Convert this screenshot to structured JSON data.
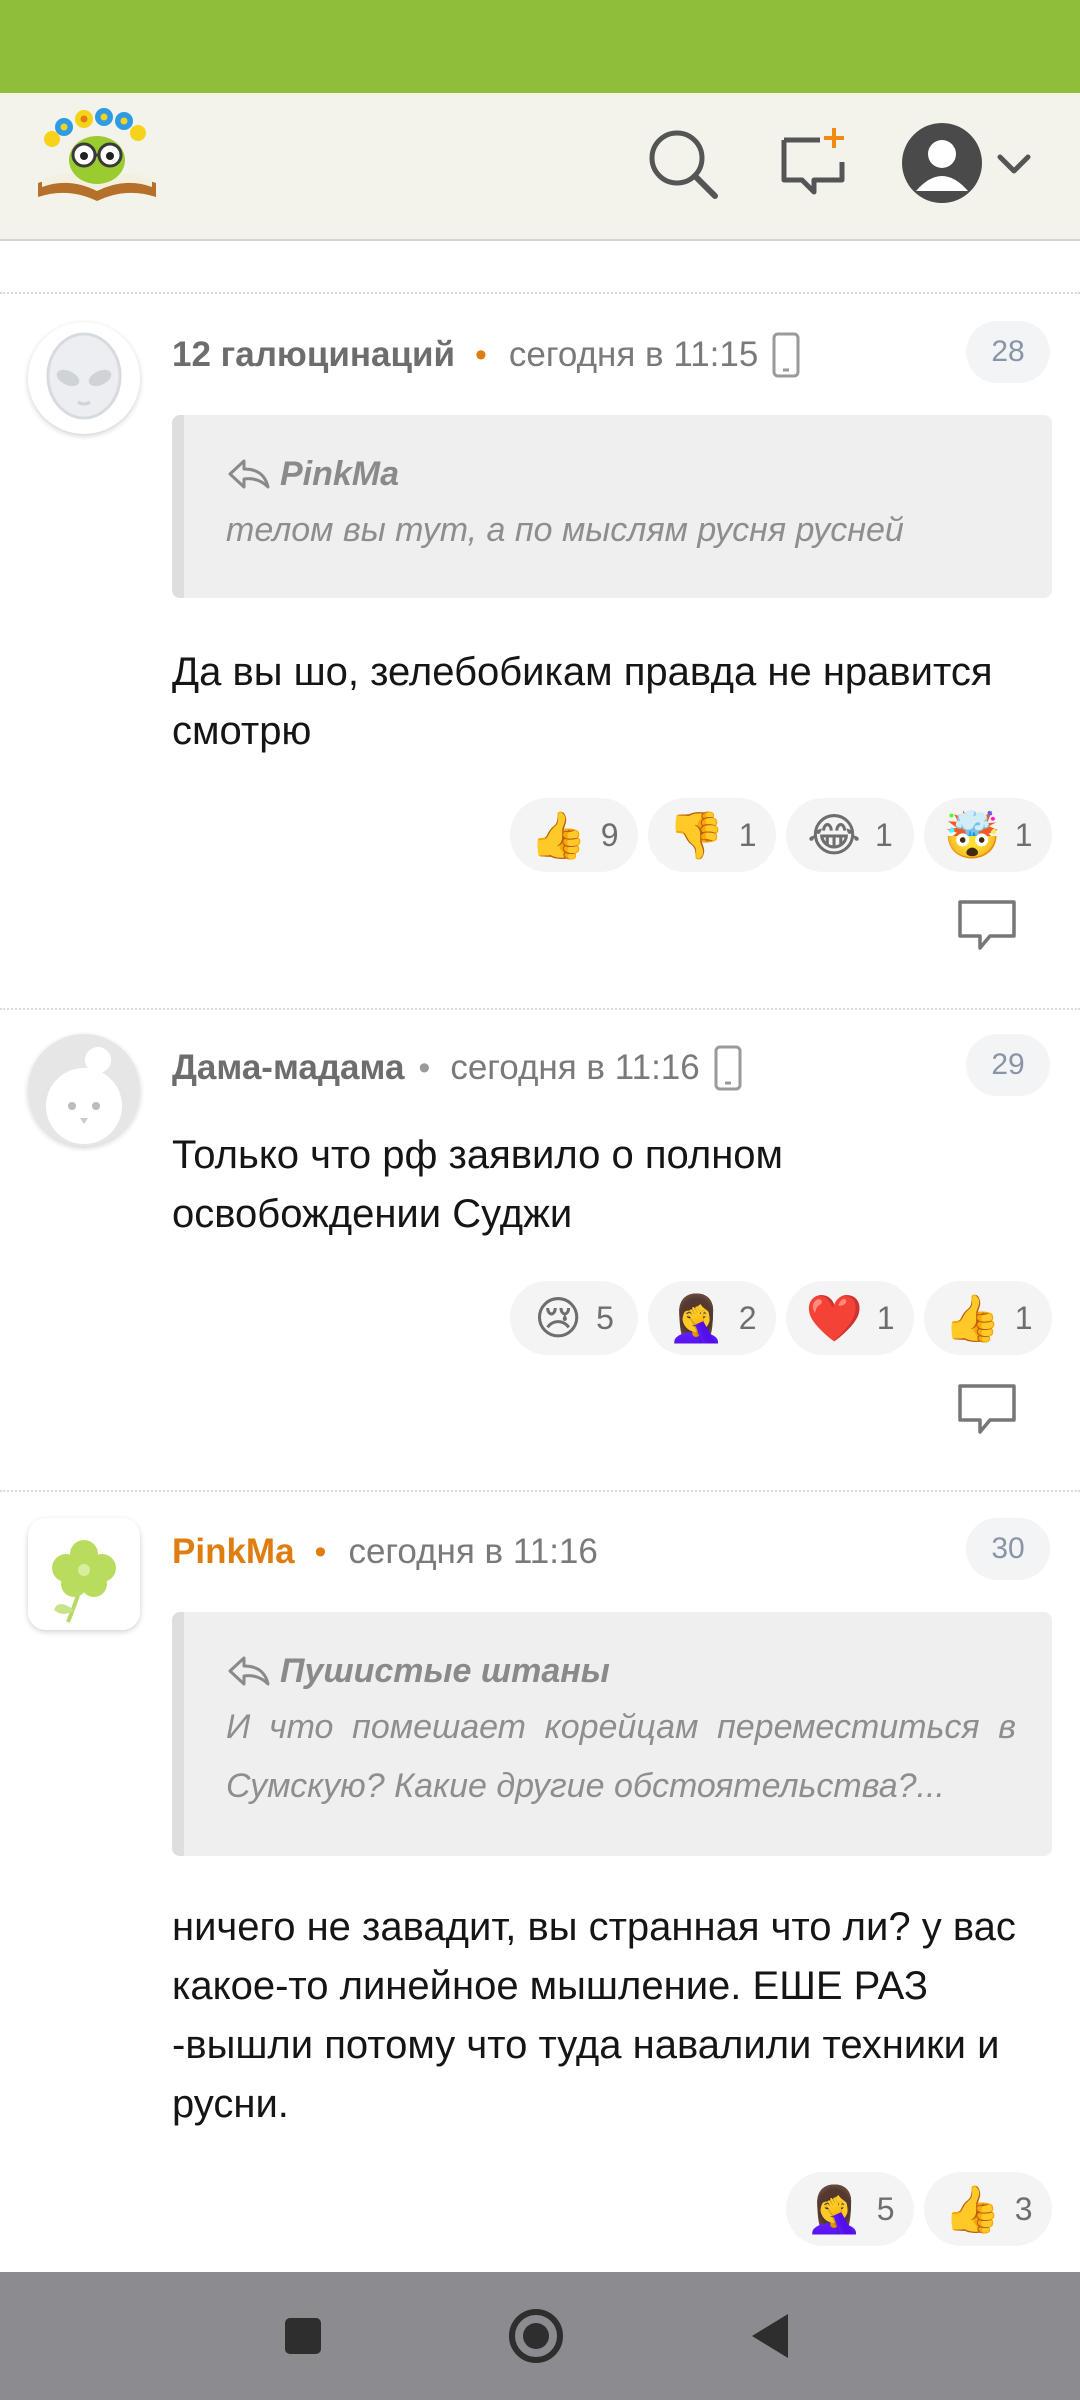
{
  "header": {
    "icons": [
      "logo",
      "search-icon",
      "new-post-icon",
      "avatar-icon",
      "chevron-down-icon"
    ]
  },
  "colors": {
    "status_bar": "#8fbf3a",
    "header_bg": "#f3f3ec",
    "accent_orange": "#e07d10",
    "nav_bar": "#8b8b90"
  },
  "comments": [
    {
      "author": "12 галюцинаций",
      "time": "сегодня в 11:15",
      "number": "28",
      "device_icon": "phone-icon",
      "quote": {
        "author": "PinkMa",
        "text": "телом вы тут, а по мыслям русня русней"
      },
      "text": "Да вы шо, зелебобикам правда не нравится смотрю",
      "reactions": [
        {
          "emoji": "👍",
          "count": "9"
        },
        {
          "emoji": "👎",
          "count": "1"
        },
        {
          "emoji": "😂",
          "count": "1"
        },
        {
          "emoji": "🤯",
          "count": "1"
        }
      ]
    },
    {
      "author": "Дама-мадама",
      "time": "сегодня в 11:16",
      "number": "29",
      "device_icon": "phone-icon",
      "text": "Только что рф заявило о полном освобождении Суджи",
      "reactions": [
        {
          "emoji": "😢",
          "count": "5"
        },
        {
          "emoji": "🤦‍♀️",
          "count": "2"
        },
        {
          "emoji": "❤️",
          "count": "1"
        },
        {
          "emoji": "👍",
          "count": "1"
        }
      ]
    },
    {
      "author": "PinkMa",
      "time": "сегодня в 11:16",
      "number": "30",
      "quote": {
        "author": "Пушистые штаны",
        "text": "И что помешает корейцам переместиться в Сумскую? Какие другие обстоятельства?..."
      },
      "text": "ничего не завадит, вы странная что ли? у вас какое-то линейное мышление. ЕШЕ РАЗ -вышли потому что туда навалили техники и русни.",
      "reactions": [
        {
          "emoji": "🤦‍♀️",
          "count": "5"
        },
        {
          "emoji": "👍",
          "count": "3"
        }
      ]
    }
  ],
  "nav": {
    "icons": [
      "recents-square-icon",
      "home-circle-icon",
      "back-triangle-icon"
    ]
  }
}
